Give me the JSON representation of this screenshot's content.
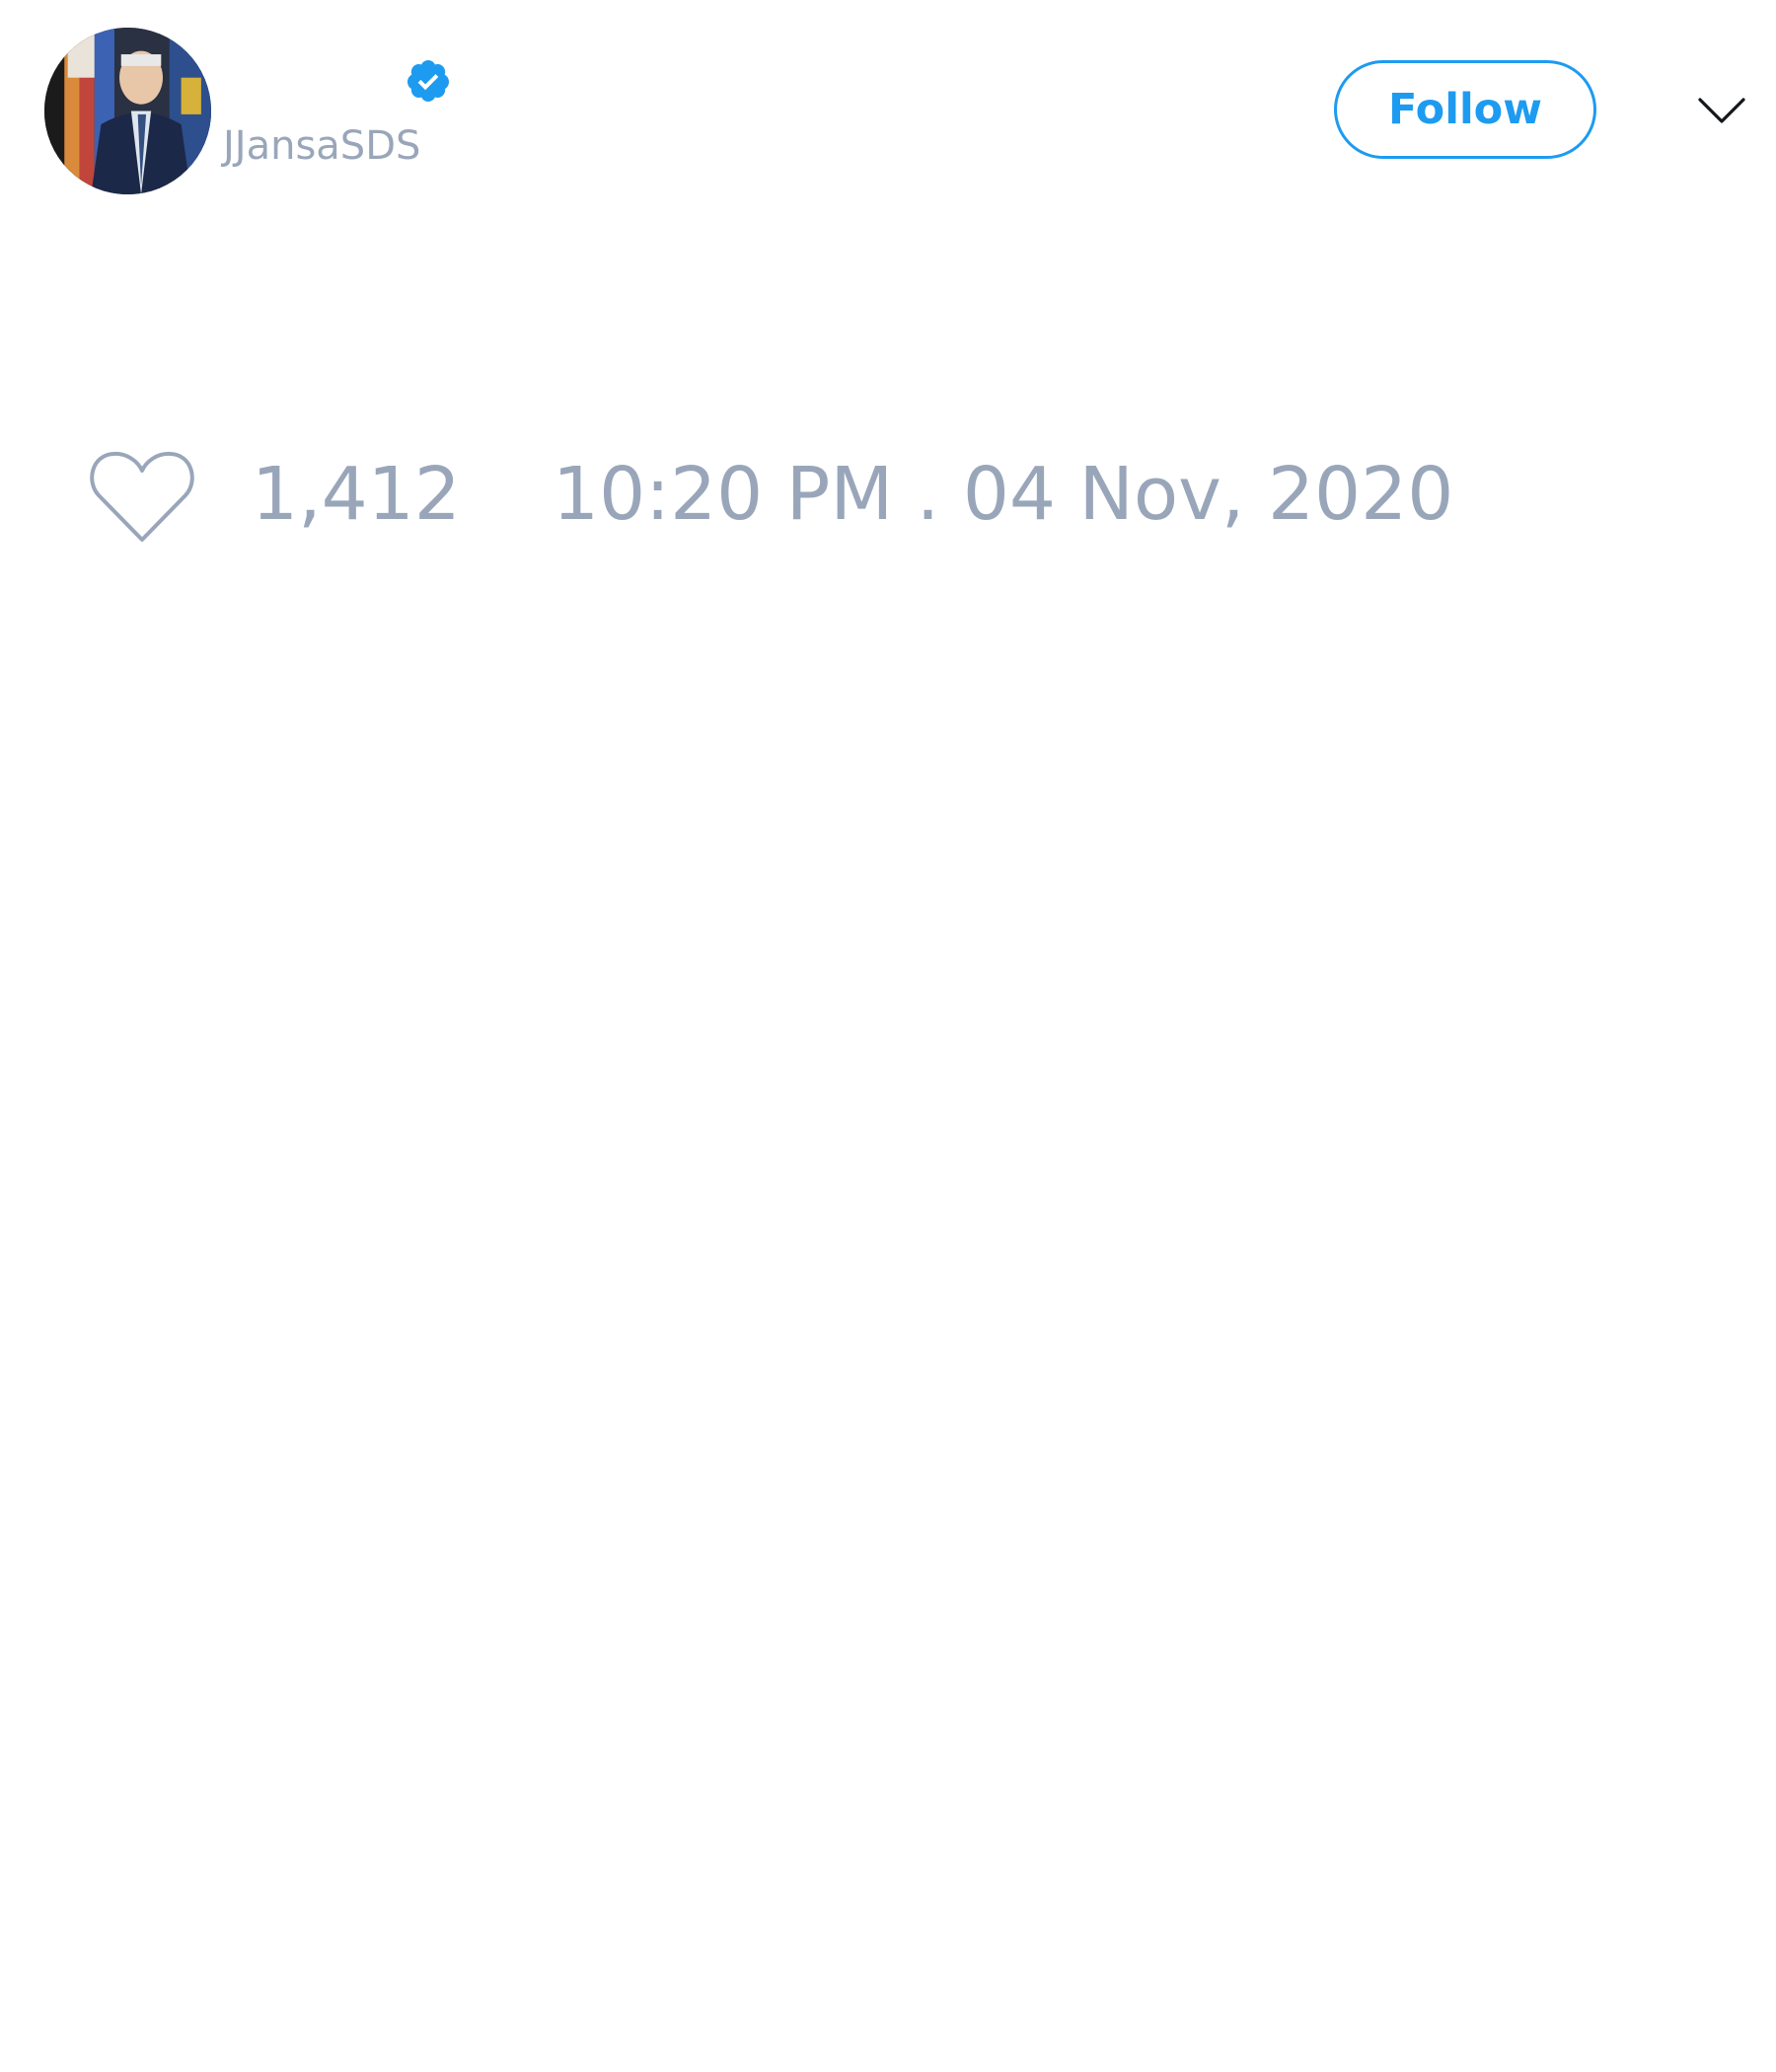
{
  "tweet": {
    "author": {
      "handle": "JJansaSDS",
      "verified": true,
      "avatar_icon": "profile-photo"
    },
    "follow_label": "Follow",
    "menu_icon": "chevron-down-icon",
    "like_icon": "heart-outline-icon",
    "like_count": "1,412",
    "timestamp": "10:20 PM . 04 Nov, 2020"
  },
  "colors": {
    "accent": "#1d9bf0",
    "muted_text": "#99a6ba",
    "background": "#ffffff"
  }
}
